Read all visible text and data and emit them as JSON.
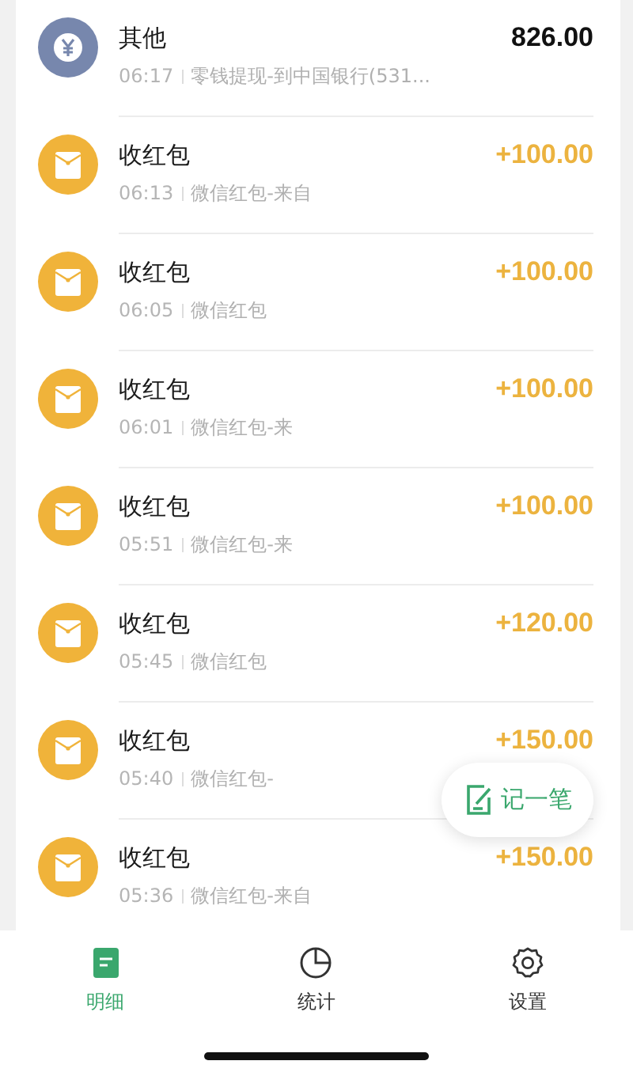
{
  "transactions": [
    {
      "kind": "other",
      "title": "其他",
      "time": "06:17",
      "description": "零钱提现-到中国银行(531...",
      "amount": "826.00"
    },
    {
      "kind": "red_packet",
      "title": "收红包",
      "time": "06:13",
      "description": "微信红包-来自",
      "amount": "+100.00"
    },
    {
      "kind": "red_packet",
      "title": "收红包",
      "time": "06:05",
      "description": "微信红包",
      "amount": "+100.00"
    },
    {
      "kind": "red_packet",
      "title": "收红包",
      "time": "06:01",
      "description": "微信红包-来",
      "amount": "+100.00"
    },
    {
      "kind": "red_packet",
      "title": "收红包",
      "time": "05:51",
      "description": "微信红包-来",
      "amount": "+100.00"
    },
    {
      "kind": "red_packet",
      "title": "收红包",
      "time": "05:45",
      "description": "微信红包",
      "amount": "+120.00"
    },
    {
      "kind": "red_packet",
      "title": "收红包",
      "time": "05:40",
      "description": "微信红包-",
      "amount": "+150.00"
    },
    {
      "kind": "red_packet",
      "title": "收红包",
      "time": "05:36",
      "description": "微信红包-来自",
      "amount": "+150.00"
    }
  ],
  "add_button": {
    "label": "记一笔"
  },
  "tabs": [
    {
      "kind": "details",
      "label": "明细",
      "selected": true
    },
    {
      "kind": "stats",
      "label": "统计",
      "selected": false
    },
    {
      "kind": "settings",
      "label": "设置",
      "selected": false
    }
  ]
}
